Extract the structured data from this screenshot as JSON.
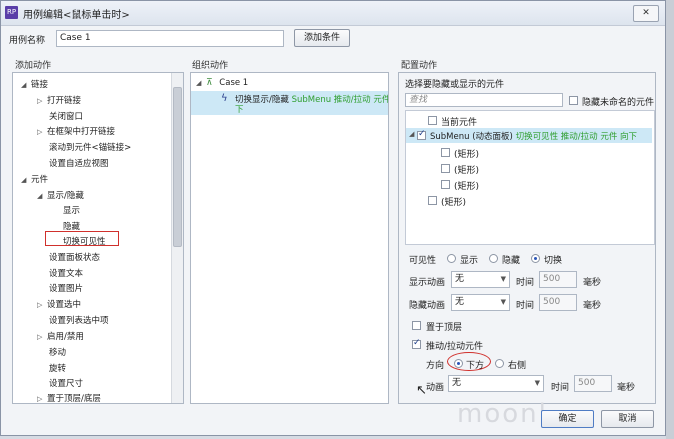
{
  "window": {
    "title": "用例编辑<鼠标单击时>",
    "app_icon": "RP",
    "close": "✕"
  },
  "case_name": {
    "label": "用例名称",
    "value": "Case 1",
    "add_condition": "添加条件"
  },
  "left": {
    "title": "添加动作",
    "items": [
      {
        "label": "链接",
        "arrow": "◢"
      },
      {
        "label": "打开链接",
        "arrow": "▷"
      },
      {
        "label": "关闭窗口",
        "arrow": ""
      },
      {
        "label": "在框架中打开链接",
        "arrow": "▷"
      },
      {
        "label": "滚动到元件<锚链接>",
        "arrow": ""
      },
      {
        "label": "设置自适应视图",
        "arrow": ""
      },
      {
        "label": "元件",
        "arrow": "◢"
      },
      {
        "label": "显示/隐藏",
        "arrow": "◢"
      },
      {
        "label": "显示",
        "arrow": ""
      },
      {
        "label": "隐藏",
        "arrow": ""
      },
      {
        "label": "切换可见性",
        "arrow": ""
      },
      {
        "label": "设置面板状态",
        "arrow": ""
      },
      {
        "label": "设置文本",
        "arrow": ""
      },
      {
        "label": "设置图片",
        "arrow": ""
      },
      {
        "label": "设置选中",
        "arrow": "▷"
      },
      {
        "label": "设置列表选中项",
        "arrow": ""
      },
      {
        "label": "启用/禁用",
        "arrow": "▷"
      },
      {
        "label": "移动",
        "arrow": ""
      },
      {
        "label": "旋转",
        "arrow": ""
      },
      {
        "label": "设置尺寸",
        "arrow": ""
      },
      {
        "label": "置于顶层/底层",
        "arrow": "▷"
      }
    ]
  },
  "middle": {
    "title": "组织动作",
    "case_label": "Case 1",
    "action_text": "切换显示/隐藏",
    "action_detail": "SubMenu 推动/拉动 元件 向",
    "action_cont": "下"
  },
  "right": {
    "title": "配置动作",
    "subtitle": "选择要隐藏或显示的元件",
    "search_placeholder": "查找",
    "hide_unnamed": "隐藏未命名的元件",
    "widgets": [
      {
        "label": "当前元件",
        "detail": ""
      },
      {
        "label": "SubMenu (动态面板)",
        "detail": "切换可见性 推动/拉动 元件 向下"
      },
      {
        "label": "(矩形)",
        "detail": ""
      },
      {
        "label": "(矩形)",
        "detail": ""
      },
      {
        "label": "(矩形)",
        "detail": ""
      },
      {
        "label": "(矩形)",
        "detail": ""
      }
    ],
    "visibility_label": "可见性",
    "vis_options": [
      "显示",
      "隐藏",
      "切换"
    ],
    "show_anim_label": "显示动画",
    "hide_anim_label": "隐藏动画",
    "anim_value": "无",
    "time_label": "时间",
    "time_value": "500",
    "ms_label": "毫秒",
    "bring_front": "置于顶层",
    "push_pull": "推动/拉动元件",
    "direction_label": "方向",
    "dir_down": "下方",
    "dir_right": "右侧",
    "anim_label": "动画"
  },
  "footer": {
    "ok": "确定",
    "cancel": "取消",
    "watermark": "moonl"
  }
}
